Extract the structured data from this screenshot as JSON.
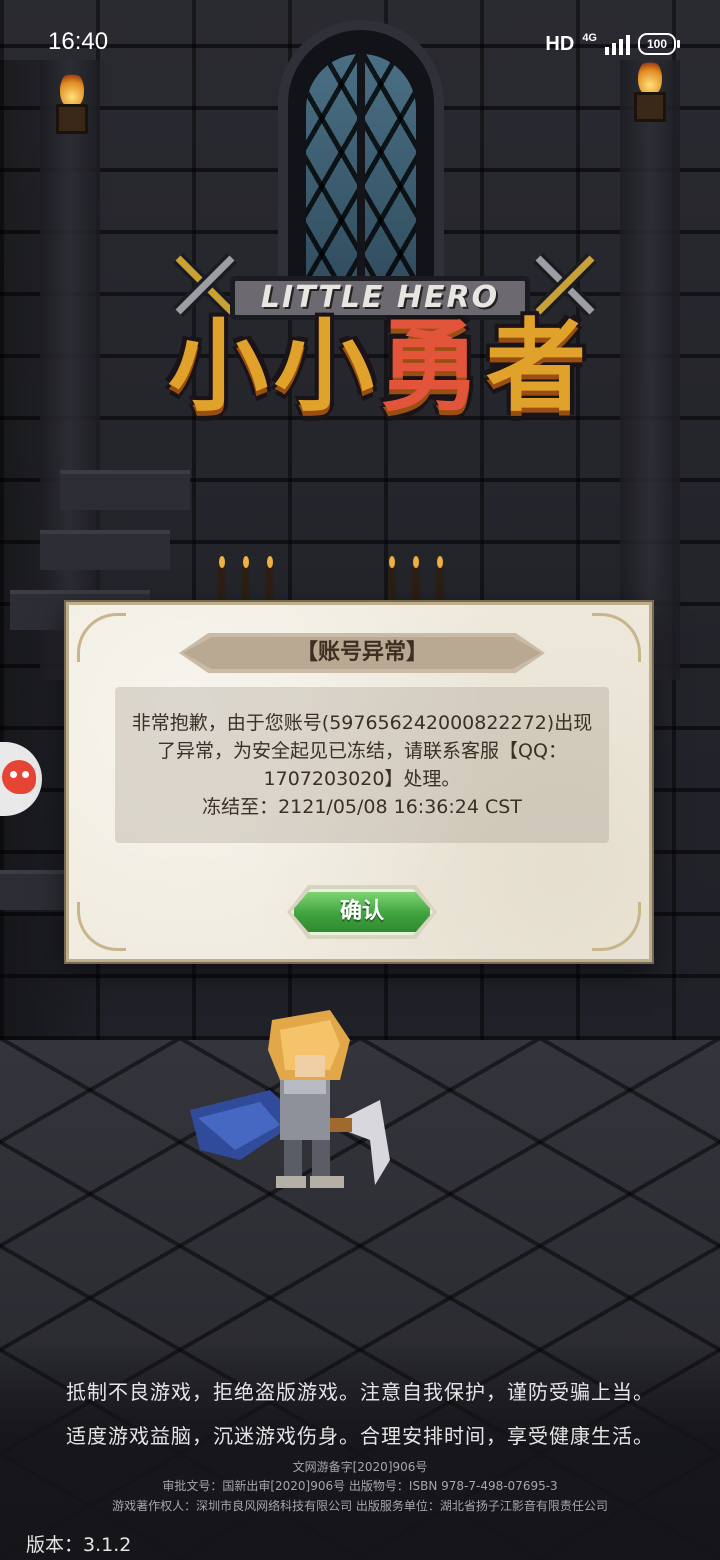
{
  "status_bar": {
    "time": "16:40",
    "hd": "HD",
    "network": "4G",
    "battery": "100"
  },
  "logo": {
    "subtitle": "LITTLE HERO",
    "title_part1": "小小",
    "title_part2": "勇",
    "title_part3": "者"
  },
  "dialog": {
    "title": "【账号异常】",
    "message": "非常抱歉，由于您账号(597656242000822272)出现了异常，为安全起见已冻结，请联系客服【QQ：1707203020】处理。",
    "freeze_until": "冻结至：2121/05/08 16:36:24 CST",
    "confirm_label": "确认"
  },
  "footer": {
    "notice_line1": "抵制不良游戏，拒绝盗版游戏。注意自我保护，谨防受骗上当。",
    "notice_line2": "适度游戏益脑，沉迷游戏伤身。合理安排时间，享受健康生活。",
    "legal_line1": "文网游备字[2020]906号",
    "legal_line2": "审批文号：国新出审[2020]906号 出版物号：ISBN 978-7-498-07695-3",
    "legal_line3": "游戏著作权人：深圳市良风网络科技有限公司 出版服务单位：湖北省扬子江影音有限责任公司",
    "version": "版本：3.1.2"
  },
  "colors": {
    "dialog_paper": "#efeadd",
    "confirm_green": "#3fa33e",
    "logo_gold": "#e0a22a",
    "logo_red": "#e2553a"
  },
  "icons": {
    "side_float": "floating-assistant-icon",
    "sword": "crossed-sword-icon"
  }
}
